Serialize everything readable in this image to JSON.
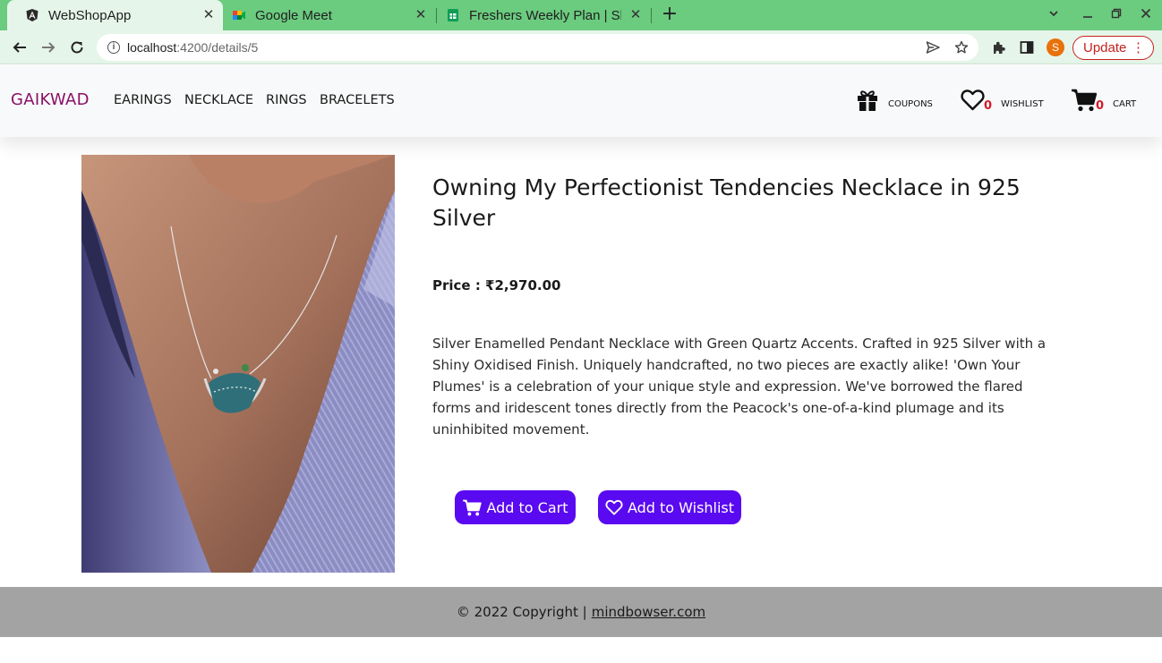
{
  "browser": {
    "tabs": [
      {
        "title": "WebShopApp",
        "icon": "angular-icon",
        "active": true
      },
      {
        "title": "Google Meet",
        "icon": "google-meet-icon",
        "active": false
      },
      {
        "title": "Freshers Weekly Plan | Sh",
        "icon": "google-sheets-icon",
        "active": false
      }
    ],
    "new_tab": "+",
    "url_host": "localhost",
    "url_path": ":4200/details/5",
    "profile_initial": "S",
    "update_label": "Update"
  },
  "header": {
    "brand": "GAIKWAD",
    "nav": [
      "EARINGS",
      "NECKLACE",
      "RINGS",
      "BRACELETS"
    ],
    "coupons_label": "COUPONS",
    "wishlist_label": "WISHLIST",
    "wishlist_count": "0",
    "cart_label": "CART",
    "cart_count": "0"
  },
  "product": {
    "title": "Owning My Perfectionist Tendencies Necklace in 925 Silver",
    "price": "Price : ₹2,970.00",
    "description": "Silver Enamelled Pendant Necklace with Green Quartz Accents. Crafted in 925 Silver with a Shiny Oxidised Finish. Uniquely handcrafted, no two pieces are exactly alike! 'Own Your Plumes' is a celebration of your unique style and expression. We've borrowed the flared forms and iridescent tones directly from the Peacock's one-of-a-kind plumage and its uninhibited movement.",
    "add_to_cart": "Add to Cart",
    "add_to_wishlist": "Add to Wishlist"
  },
  "footer": {
    "copyright": "© 2022 Copyright |",
    "link": "mindbowser.com"
  },
  "colors": {
    "tabbar": "#6bcb7f",
    "toolbar": "#e6f5e9",
    "brand": "#8a1166",
    "button": "#5a0af0",
    "badge": "#d11a2a",
    "footer": "#a3a3a3"
  }
}
